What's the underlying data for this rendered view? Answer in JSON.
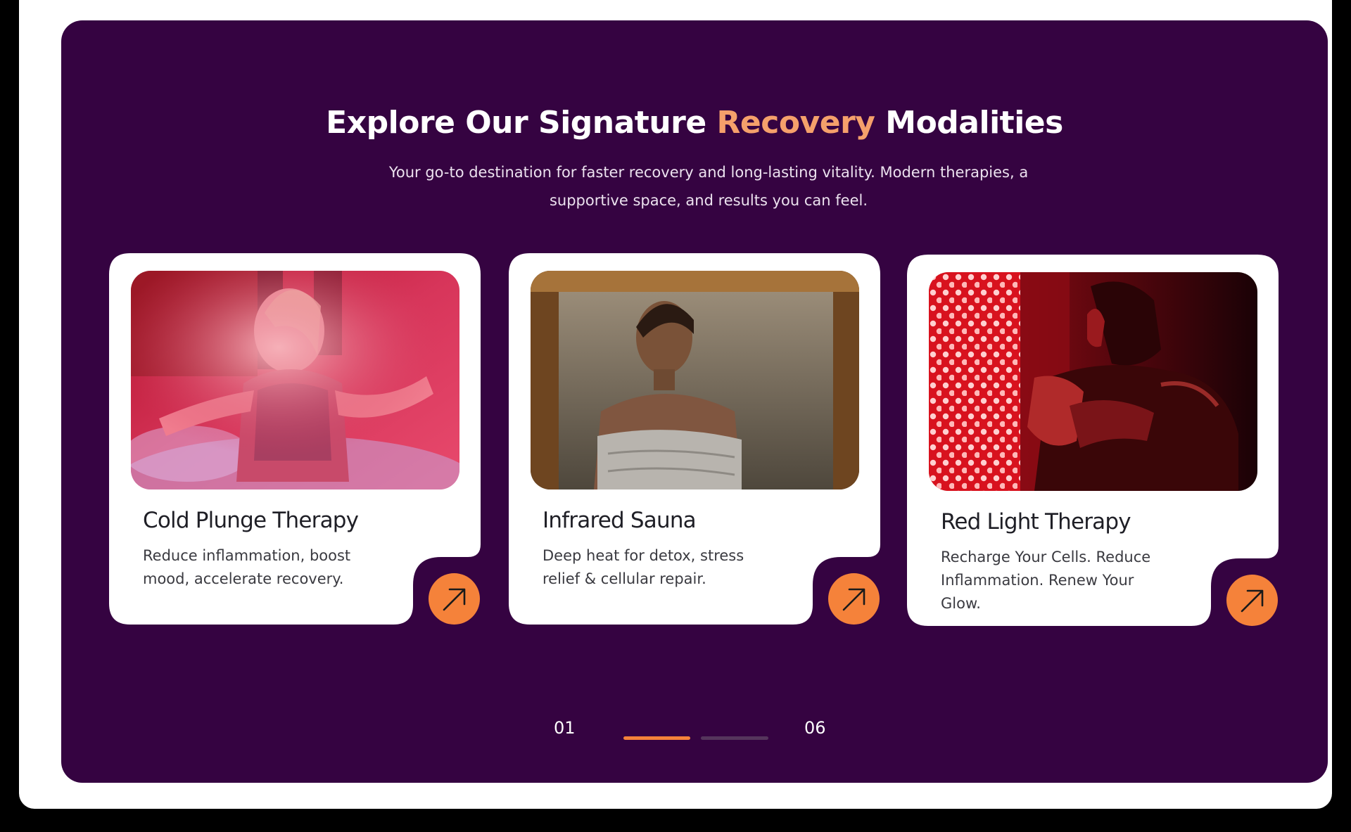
{
  "section": {
    "title_before": "Explore Our Signature",
    "title_accent": "Recovery",
    "title_after": "Modalities",
    "subtitle": "Your go-to destination for faster recovery and long-lasting vitality. Modern therapies, a supportive space, and results you can feel."
  },
  "colors": {
    "section_bg": "#350341",
    "accent_text": "#f5a06b",
    "button": "#f5823a",
    "card_bg": "#ffffff"
  },
  "cards": [
    {
      "title": "Cold Plunge Therapy",
      "description": "Reduce inflammation, boost mood, accelerate recovery.",
      "image": "woman-in-cold-plunge-tub",
      "button_icon": "arrow-up-right-icon"
    },
    {
      "title": "Infrared Sauna",
      "description": "Deep heat for detox, stress relief & cellular repair.",
      "image": "woman-in-sauna-towel",
      "button_icon": "arrow-up-right-icon"
    },
    {
      "title": "Red Light Therapy",
      "description": "Recharge Your Cells. Reduce Inflammation. Renew Your Glow.",
      "image": "man-red-light-panel",
      "button_icon": "arrow-up-right-icon"
    }
  ],
  "pager": {
    "current": "01",
    "total": "06",
    "progress": 0.5
  }
}
